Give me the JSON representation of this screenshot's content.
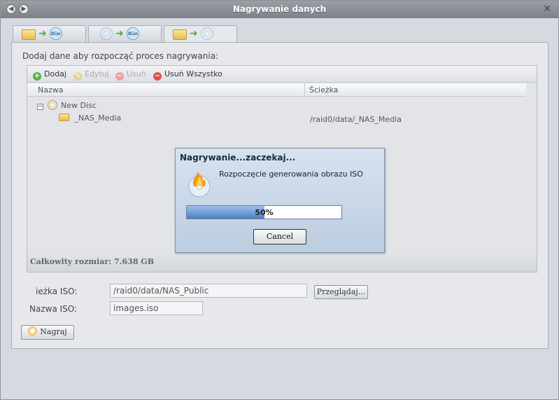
{
  "window": {
    "title": "Nagrywanie danych",
    "back_glyph": "◀",
    "forward_glyph": "▶",
    "close_glyph": "✕"
  },
  "tabs": [
    {
      "icon": "folder-to-disc",
      "disc_label": "Disc"
    },
    {
      "icon": "image-to-disc",
      "disc_label": "Disc"
    },
    {
      "icon": "folder-to-image",
      "disc_label": ""
    }
  ],
  "panel": {
    "instruction": "Dodaj dane aby rozpocząć proces nagrywania:",
    "toolbar": {
      "add": "Dodaj",
      "edit": "Edytuj",
      "remove": "Usuń",
      "remove_all": "Usuń Wszystko"
    },
    "columns": {
      "name": "Nazwa",
      "path": "Ścieżka"
    },
    "tree": {
      "root": "New Disc",
      "expander": "−",
      "items": [
        {
          "name": "_NAS_Media",
          "path": "/raid0/data/_NAS_Media"
        }
      ]
    },
    "total_size": "Całkowity rozmiar: 7.638 GB"
  },
  "iso": {
    "path_label": "ieżka ISO:",
    "path_value": "/raid0/data/NAS_Public",
    "browse_button": "Przeglądaj...",
    "name_label": "Nazwa ISO:",
    "name_value": "images.iso"
  },
  "burn_button": "Nagraj",
  "dialog": {
    "title": "Nagrywanie...zaczekaj...",
    "message": "Rozpoczęcie generowania obrazu ISO",
    "progress": 0.5,
    "progress_text": "50%",
    "cancel": "Cancel"
  },
  "colors": {
    "accent": "#4b7fc2",
    "titlebar": "#8a8e96"
  }
}
